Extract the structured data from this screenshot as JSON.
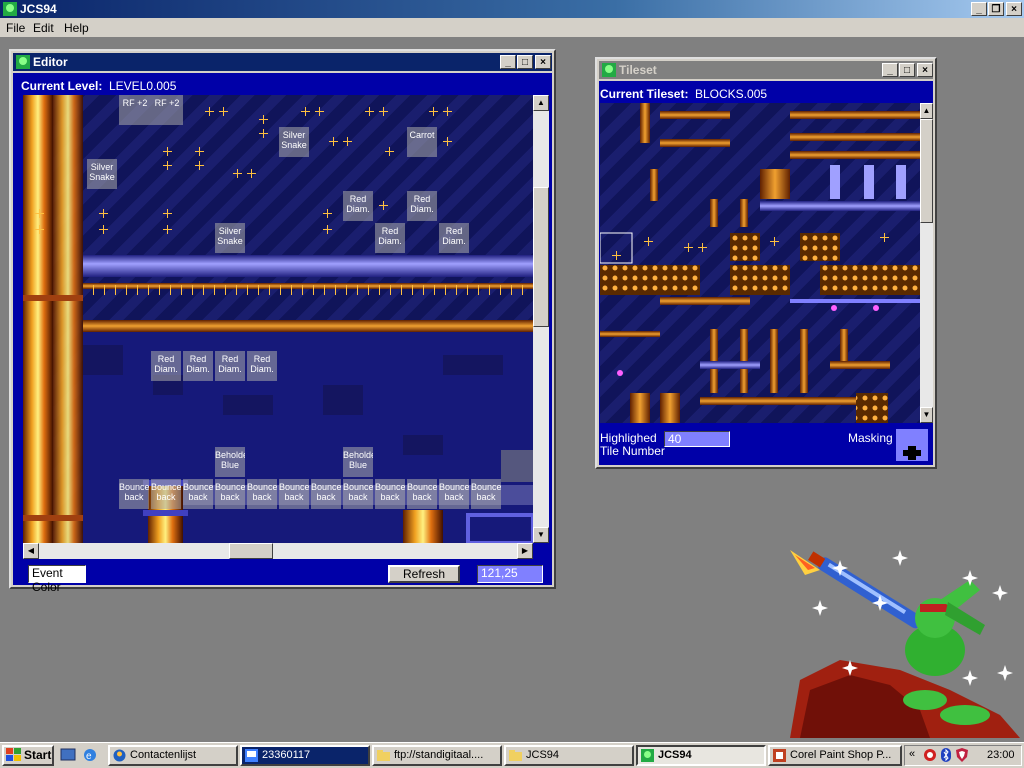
{
  "app": {
    "title": "JCS94"
  },
  "menu": [
    "File",
    "Edit",
    "Help"
  ],
  "editor": {
    "title": "Editor",
    "current_level_label": "Current Level:",
    "current_level_value": "LEVEL0.005",
    "event_color_label": "Event Color",
    "refresh_label": "Refresh",
    "coords": "121,25",
    "events": [
      "RF +2",
      "RF +2",
      "Silver Snake",
      "Carrot",
      "Silver Snake",
      "Red Diam.",
      "Red Diam.",
      "Silver Snake",
      "Red Diam.",
      "Red Diam.",
      "Red Diam.",
      "Red Diam.",
      "Red Diam.",
      "Red Diam.",
      "Beholde Blue",
      "Beholde Blue",
      "Bounce back",
      "Bounce back",
      "Bounce back",
      "Bounce back",
      "Bounce back",
      "Bounce back",
      "Bounce back",
      "Bounce back",
      "Bounce back",
      "Bounce back",
      "Bounce back",
      "Bounce back"
    ]
  },
  "tileset": {
    "title": "Tileset",
    "current_tileset_label": "Current Tileset:",
    "current_tileset_value": "BLOCKS.005",
    "highlighted_label_line1": "Highlighed",
    "highlighted_label_line2": "Tile Number",
    "highlighted_value": "40",
    "masking_label": "Masking"
  },
  "taskbar": {
    "start": "Start",
    "items": [
      "Contactenlijst",
      "23360117",
      "ftp://standigitaal....",
      "JCS94",
      "JCS94",
      "Corel Paint Shop P..."
    ],
    "clock": "23:00",
    "chevron": "«"
  },
  "colors": {
    "title_active": "#0a246a",
    "window_bg": "#d4d0c8",
    "panel_blue": "#0000a8",
    "desktop": "#808080",
    "pipe_orange": "#e08020",
    "pipe_blue": "#4040e0"
  }
}
